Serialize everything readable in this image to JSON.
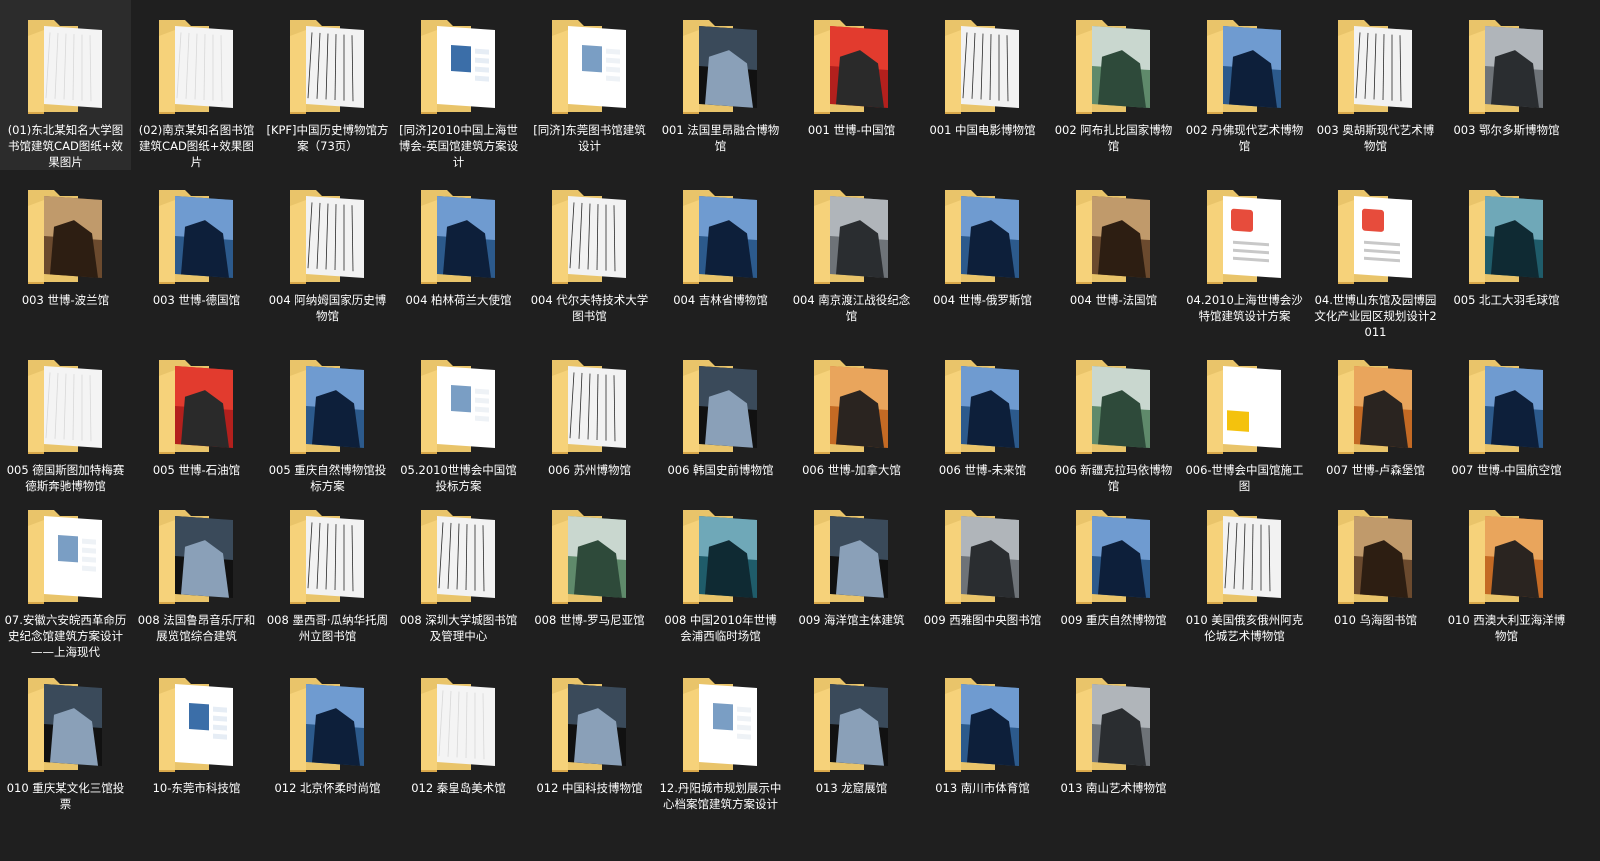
{
  "items": [
    {
      "label": "(01)东北某知名大学图书馆建筑CAD图纸+效果图片",
      "preview": "white"
    },
    {
      "label": "(02)南京某知名图书馆建筑CAD图纸+效果图片",
      "preview": "white"
    },
    {
      "label": "[KPF]中国历史博物馆方案（73页）",
      "preview": "plan"
    },
    {
      "label": "[同济]2010中国上海世博会-英国馆建筑方案设计",
      "preview": "doc"
    },
    {
      "label": "[同济]东莞图书馆建筑设计",
      "preview": "folder-doc"
    },
    {
      "label": "001 法国里昂融合博物馆",
      "preview": "dark"
    },
    {
      "label": "001 世博-中国馆",
      "preview": "red"
    },
    {
      "label": "001 中国电影博物馆",
      "preview": "plan"
    },
    {
      "label": "002 阿布扎比国家博物馆",
      "preview": "green"
    },
    {
      "label": "002 丹佛现代艺术博物馆",
      "preview": "blue"
    },
    {
      "label": "003 奥胡斯现代艺术博物馆",
      "preview": "plan"
    },
    {
      "label": "003 鄂尔多斯博物馆",
      "preview": "grey"
    },
    {
      "label": "003 世博-波兰馆",
      "preview": "brown"
    },
    {
      "label": "003 世博-德国馆",
      "preview": "blue"
    },
    {
      "label": "004 阿纳姆国家历史博物馆",
      "preview": "plan"
    },
    {
      "label": "004 柏林荷兰大使馆",
      "preview": "blue"
    },
    {
      "label": "004 代尔夫特技术大学图书馆",
      "preview": "plan"
    },
    {
      "label": "004 吉林省博物馆",
      "preview": "blue"
    },
    {
      "label": "004 南京渡江战役纪念馆",
      "preview": "grey"
    },
    {
      "label": "004 世博-俄罗斯馆",
      "preview": "blue"
    },
    {
      "label": "004 世博-法国馆",
      "preview": "brown"
    },
    {
      "label": "04.2010上海世博会沙特馆建筑设计方案",
      "preview": "pdf"
    },
    {
      "label": "04.世博山东馆及园博园文化产业园区规划设计2011",
      "preview": "pdf"
    },
    {
      "label": "005 北工大羽毛球馆",
      "preview": "teal"
    },
    {
      "label": "005 德国斯图加特梅赛德斯奔驰博物馆",
      "preview": "white"
    },
    {
      "label": "005 世博-石油馆",
      "preview": "red"
    },
    {
      "label": "005 重庆自然博物馆投标方案",
      "preview": "blue"
    },
    {
      "label": "05.2010世博会中国馆投标方案",
      "preview": "folder-doc"
    },
    {
      "label": "006 苏州博物馆",
      "preview": "plan"
    },
    {
      "label": "006 韩国史前博物馆",
      "preview": "dark"
    },
    {
      "label": "006 世博-加拿大馆",
      "preview": "orange"
    },
    {
      "label": "006 世博-未来馆",
      "preview": "blue"
    },
    {
      "label": "006 新疆克拉玛依博物馆",
      "preview": "green"
    },
    {
      "label": "006-世博会中国馆施工图",
      "preview": "tm"
    },
    {
      "label": "007 世博-卢森堡馆",
      "preview": "orange"
    },
    {
      "label": "007 世博-中国航空馆",
      "preview": "blue"
    },
    {
      "label": "07.安徽六安皖西革命历史纪念馆建筑方案设计——上海现代",
      "preview": "folder-doc"
    },
    {
      "label": "008 法国鲁昂音乐厅和展览馆综合建筑",
      "preview": "dark"
    },
    {
      "label": "008 墨西哥·瓜纳华托周州立图书馆",
      "preview": "plan"
    },
    {
      "label": "008 深圳大学城图书馆及管理中心",
      "preview": "plan"
    },
    {
      "label": "008 世博-罗马尼亚馆",
      "preview": "green"
    },
    {
      "label": "008 中国2010年世博会浦西临时场馆",
      "preview": "teal"
    },
    {
      "label": "009 海洋馆主体建筑",
      "preview": "dark"
    },
    {
      "label": "009 西雅图中央图书馆",
      "preview": "grey"
    },
    {
      "label": "009 重庆自然博物馆",
      "preview": "blue"
    },
    {
      "label": "010 美国俄亥俄州阿克伦城艺术博物馆",
      "preview": "plan"
    },
    {
      "label": "010 乌海图书馆",
      "preview": "brown"
    },
    {
      "label": "010 西澳大利亚海洋博物馆",
      "preview": "orange"
    },
    {
      "label": "010 重庆某文化三馆投票",
      "preview": "dark"
    },
    {
      "label": "10-东莞市科技馆",
      "preview": "doc"
    },
    {
      "label": "012 北京怀柔时尚馆",
      "preview": "blue"
    },
    {
      "label": "012 秦皇岛美术馆",
      "preview": "white"
    },
    {
      "label": "012 中国科技博物馆",
      "preview": "dark"
    },
    {
      "label": "12.丹阳城市规划展示中心档案馆建筑方案设计",
      "preview": "folder-doc"
    },
    {
      "label": "013 龙窟展馆",
      "preview": "dark"
    },
    {
      "label": "013 南川市体育馆",
      "preview": "blue"
    },
    {
      "label": "013 南山艺术博物馆",
      "preview": "grey"
    }
  ]
}
